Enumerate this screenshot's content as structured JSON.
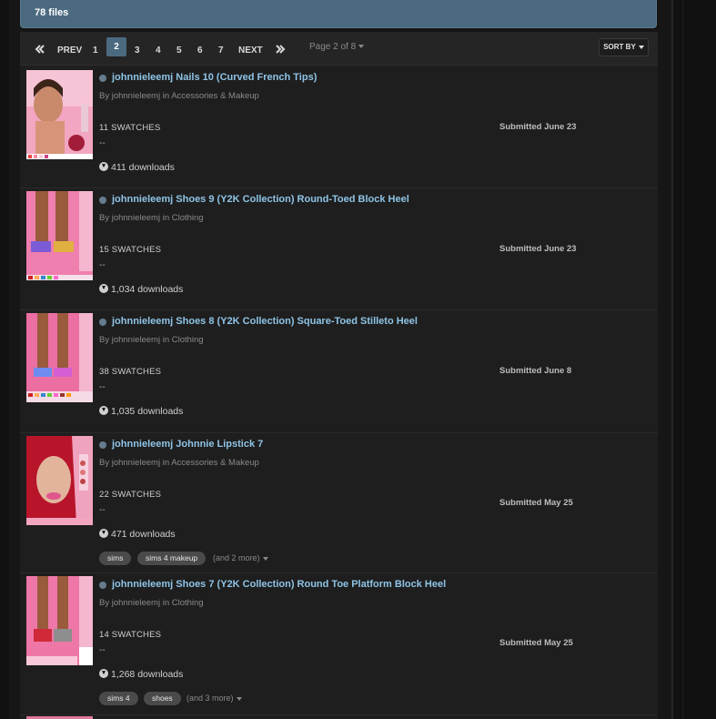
{
  "header": {
    "file_count": "78 files"
  },
  "pagination": {
    "prev_label": "PREV",
    "next_label": "NEXT",
    "pages": [
      "1",
      "2",
      "3",
      "4",
      "5",
      "6",
      "7"
    ],
    "current_page": "2",
    "page_of": "Page 2 of 8",
    "sort_by": "SORT BY"
  },
  "files": [
    {
      "title": "johnnieleemj Nails 10 (Curved French Tips)",
      "byline": "By johnnieleemj in Accessories & Makeup",
      "swatches": "11 SWATCHES",
      "dash": "--",
      "downloads": "411 downloads",
      "submitted": "Submitted June 23",
      "tags": []
    },
    {
      "title": "johnnieleemj Shoes 9 (Y2K Collection) Round-Toed Block Heel",
      "byline": "By johnnieleemj in Clothing",
      "swatches": "15 SWATCHES",
      "dash": "--",
      "downloads": "1,034 downloads",
      "submitted": "Submitted June 23",
      "tags": []
    },
    {
      "title": "johnnieleemj Shoes 8 (Y2K Collection) Square-Toed Stilleto Heel",
      "byline": "By johnnieleemj in Clothing",
      "swatches": "38 SWATCHES",
      "dash": "--",
      "downloads": "1,035 downloads",
      "submitted": "Submitted June 8",
      "tags": []
    },
    {
      "title": "johnnieleemj Johnnie Lipstick 7",
      "byline": "By johnnieleemj in Accessories & Makeup",
      "swatches": "22 SWATCHES",
      "dash": "--",
      "downloads": "471 downloads",
      "submitted": "Submitted May 25",
      "tags": [
        "sims",
        "sims 4 makeup"
      ],
      "more_tags": "(and 2 more)"
    },
    {
      "title": "johnnieleemj Shoes 7 (Y2K Collection) Round Toe Platform Block Heel",
      "byline": "By johnnieleemj in Clothing",
      "swatches": "14 SWATCHES",
      "dash": "--",
      "downloads": "1,268 downloads",
      "submitted": "Submitted May 25",
      "tags": [
        "sims 4",
        "shoes"
      ],
      "more_tags": "(and 3 more)"
    }
  ],
  "colors": {
    "accent": "#4b6a80",
    "link": "#8ec4e6",
    "background": "#1e1e1e"
  }
}
